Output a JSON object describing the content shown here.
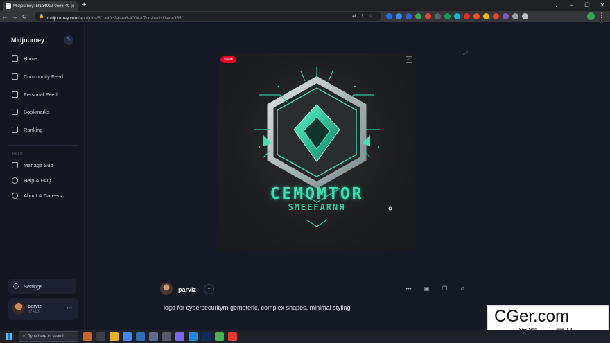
{
  "browser": {
    "tab_title": "Midjourney: 5f1a49c2-0ee6-400",
    "url_host": "midjourney.com",
    "url_path": "/app/jobs/5f1a49c2-0ee6-4004-b7dc-becb114c4355/"
  },
  "sidebar": {
    "brand": "Midjourney",
    "nav": [
      {
        "label": "Home"
      },
      {
        "label": "Community Feed"
      },
      {
        "label": "Personal Feed"
      },
      {
        "label": "Bookmarks"
      },
      {
        "label": "Ranking"
      }
    ],
    "help_label": "HELP",
    "help_items": [
      {
        "label": "Manage Sub"
      },
      {
        "label": "Help & FAQ"
      },
      {
        "label": "About & Careers"
      }
    ],
    "settings_label": "Settings",
    "user": {
      "name": "parviz",
      "id": "#7413"
    }
  },
  "job": {
    "save_label": "Save",
    "image_text_line1": "CEMOMTOR",
    "image_text_line2": "SMEEFARNЯ",
    "author": "parviz",
    "prompt": "logo for cybersecurityrn gemoteric, complex shapes, minimal styling"
  },
  "taskbar": {
    "search_placeholder": "Type here to search"
  },
  "watermark": {
    "line1": "CGer.com",
    "line2": "CG资源 CG网站"
  }
}
